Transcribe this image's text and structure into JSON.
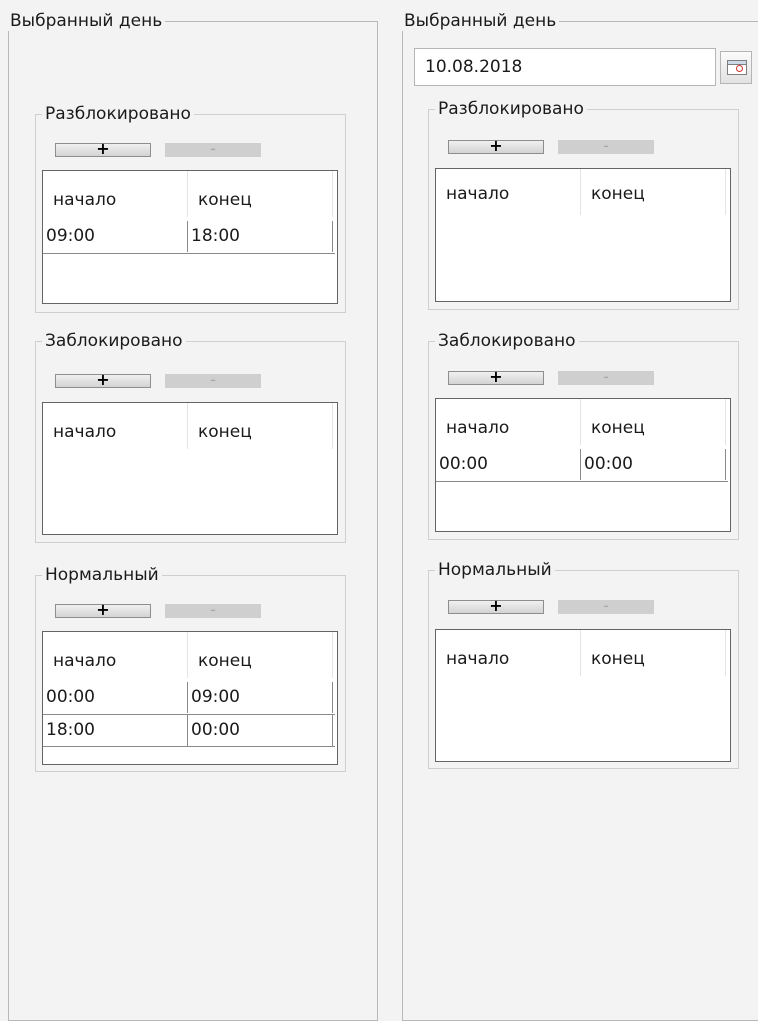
{
  "panels": [
    {
      "title": "Выбранный день",
      "sections": [
        {
          "title": "Разблокировано",
          "add_label": "+",
          "remove_label": "-",
          "columns": [
            "начало",
            "конец"
          ],
          "rows": [
            [
              "09:00",
              "18:00"
            ]
          ]
        },
        {
          "title": "Заблокировано",
          "add_label": "+",
          "remove_label": "-",
          "columns": [
            "начало",
            "конец"
          ],
          "rows": []
        },
        {
          "title": "Нормальный",
          "add_label": "+",
          "remove_label": "-",
          "columns": [
            "начало",
            "конец"
          ],
          "rows": [
            [
              "00:00",
              "09:00"
            ],
            [
              "18:00",
              "00:00"
            ]
          ]
        }
      ]
    },
    {
      "title": "Выбранный день",
      "date_value": "10.08.2018",
      "calendar_icon": "calendar-icon",
      "sections": [
        {
          "title": "Разблокировано",
          "add_label": "+",
          "remove_label": "-",
          "columns": [
            "начало",
            "конец"
          ],
          "rows": []
        },
        {
          "title": "Заблокировано",
          "add_label": "+",
          "remove_label": "-",
          "columns": [
            "начало",
            "конец"
          ],
          "rows": [
            [
              "00:00",
              "00:00"
            ]
          ]
        },
        {
          "title": "Нормальный",
          "add_label": "+",
          "remove_label": "-",
          "columns": [
            "начало",
            "конец"
          ],
          "rows": []
        }
      ]
    }
  ]
}
